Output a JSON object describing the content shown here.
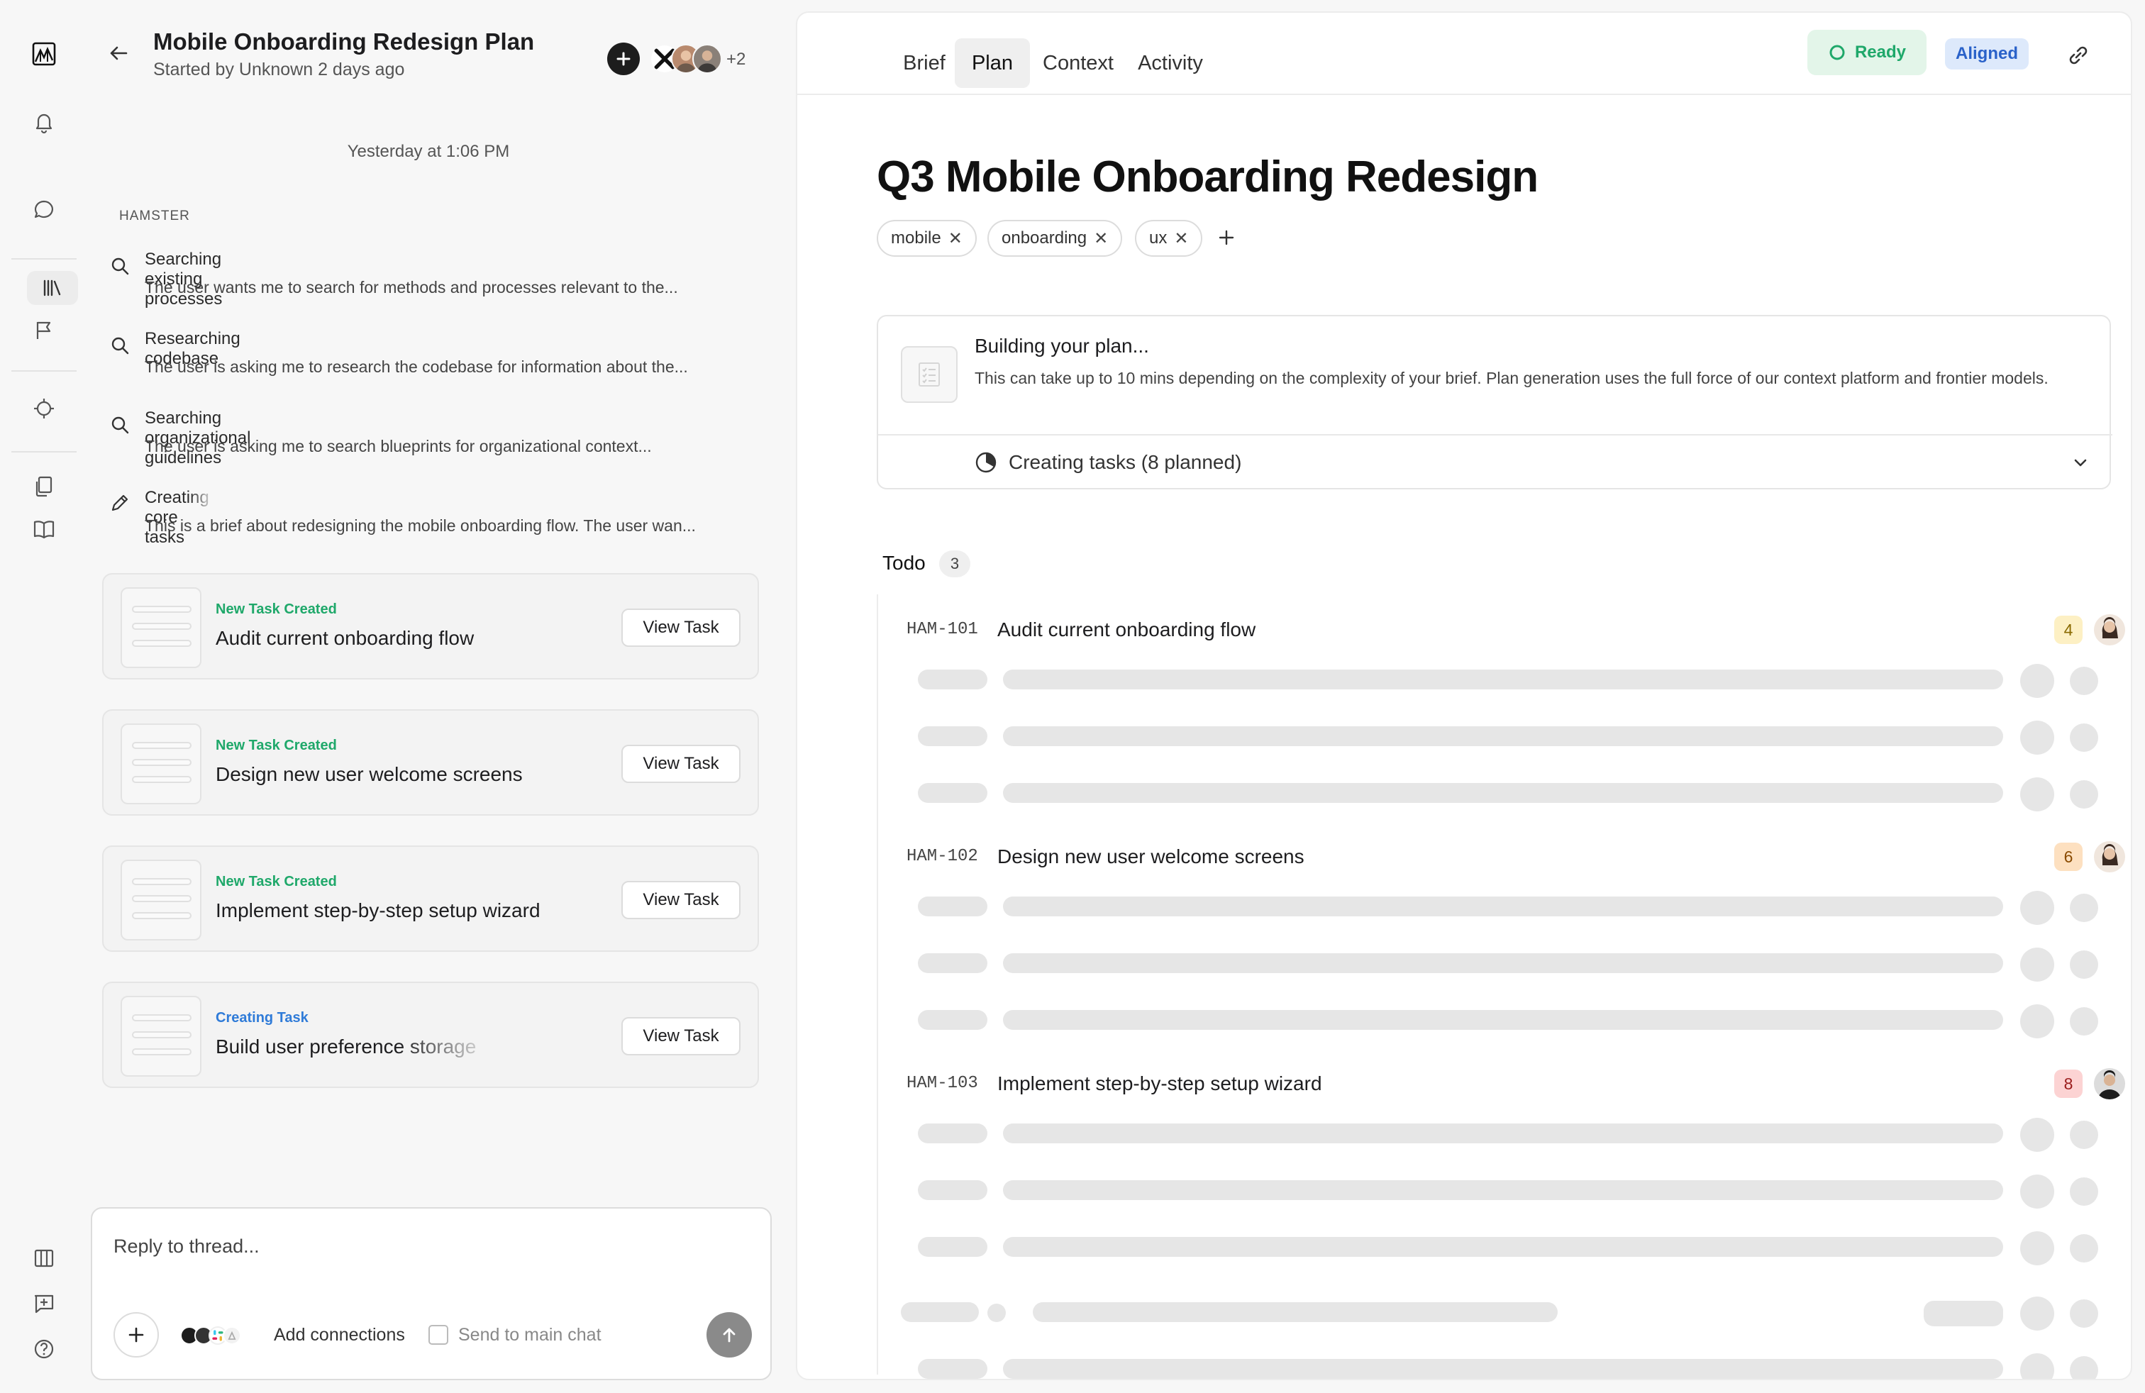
{
  "rail": {
    "items": [
      {
        "icon": "app-logo-icon"
      },
      {
        "icon": "bell-icon"
      },
      {
        "icon": "chat-bubble-icon"
      },
      {
        "icon": "library-icon"
      },
      {
        "icon": "flag-icon"
      },
      {
        "icon": "crosshair-icon"
      },
      {
        "icon": "documents-icon"
      },
      {
        "icon": "book-icon"
      },
      {
        "icon": "columns-icon"
      },
      {
        "icon": "feedback-icon"
      },
      {
        "icon": "help-icon"
      }
    ]
  },
  "thread": {
    "title": "Mobile Onboarding Redesign Plan",
    "subtitle": "Started by Unknown 2 days ago",
    "participants_more": "+2",
    "timestamp": "Yesterday at 1:06 PM",
    "agent_label": "HAMSTER",
    "steps": [
      {
        "icon": "search-icon",
        "title": "Searching existing processes",
        "desc": "The user wants me to search for methods and processes relevant to the..."
      },
      {
        "icon": "search-icon",
        "title": "Researching codebase",
        "desc": "The user is asking me to research the codebase for information about the..."
      },
      {
        "icon": "search-icon",
        "title": "Searching organizational guidelines",
        "desc": "The user is asking me to search blueprints for organizational context..."
      },
      {
        "icon": "pencil-icon",
        "title": "Creating core tasks",
        "desc": "This is a brief about redesigning the mobile onboarding flow. The user wan..."
      }
    ],
    "cards": [
      {
        "status": "New Task Created",
        "title": "Audit current onboarding flow",
        "button": "View Task"
      },
      {
        "status": "New Task Created",
        "title": "Design new user welcome screens",
        "button": "View Task"
      },
      {
        "status": "New Task Created",
        "title": "Implement step-by-step setup wizard",
        "button": "View Task"
      },
      {
        "status": "Creating Task",
        "title": "Build user preference storage",
        "button": "View Task"
      }
    ],
    "reply": {
      "placeholder": "Reply to thread...",
      "add_connections": "Add connections",
      "send_to_main": "Send to main chat"
    }
  },
  "main": {
    "tabs": [
      "Brief",
      "Plan",
      "Context",
      "Activity"
    ],
    "active_tab": "Plan",
    "status_ready": "Ready",
    "status_aligned": "Aligned",
    "title": "Q3 Mobile Onboarding Redesign",
    "tags": [
      "mobile",
      "onboarding",
      "ux"
    ],
    "building": {
      "title": "Building your plan...",
      "desc": "This can take up to 10 mins depending on the complexity of your brief. Plan generation uses the full force of our context platform and frontier models.",
      "progress": "Creating tasks (8 planned)"
    },
    "todo": {
      "label": "Todo",
      "count": "3",
      "rows": [
        {
          "id": "HAM-101",
          "title": "Audit current onboarding flow",
          "badge": "4",
          "badge_bg": "#fdf0c4",
          "badge_fg": "#8a6a00"
        },
        {
          "id": "HAM-102",
          "title": "Design new user welcome screens",
          "badge": "6",
          "badge_bg": "#fde0c0",
          "badge_fg": "#8a4a00"
        },
        {
          "id": "HAM-103",
          "title": "Implement step-by-step setup wizard",
          "badge": "8",
          "badge_bg": "#fcd3d3",
          "badge_fg": "#9a1d1d"
        }
      ]
    }
  },
  "colors": {
    "accent_green": "#1fa86a",
    "ready_bg": "#e3f5e9",
    "aligned_bg": "#dde9fb",
    "aligned_fg": "#2a62c9",
    "creating_blue": "#2f7bd8"
  }
}
